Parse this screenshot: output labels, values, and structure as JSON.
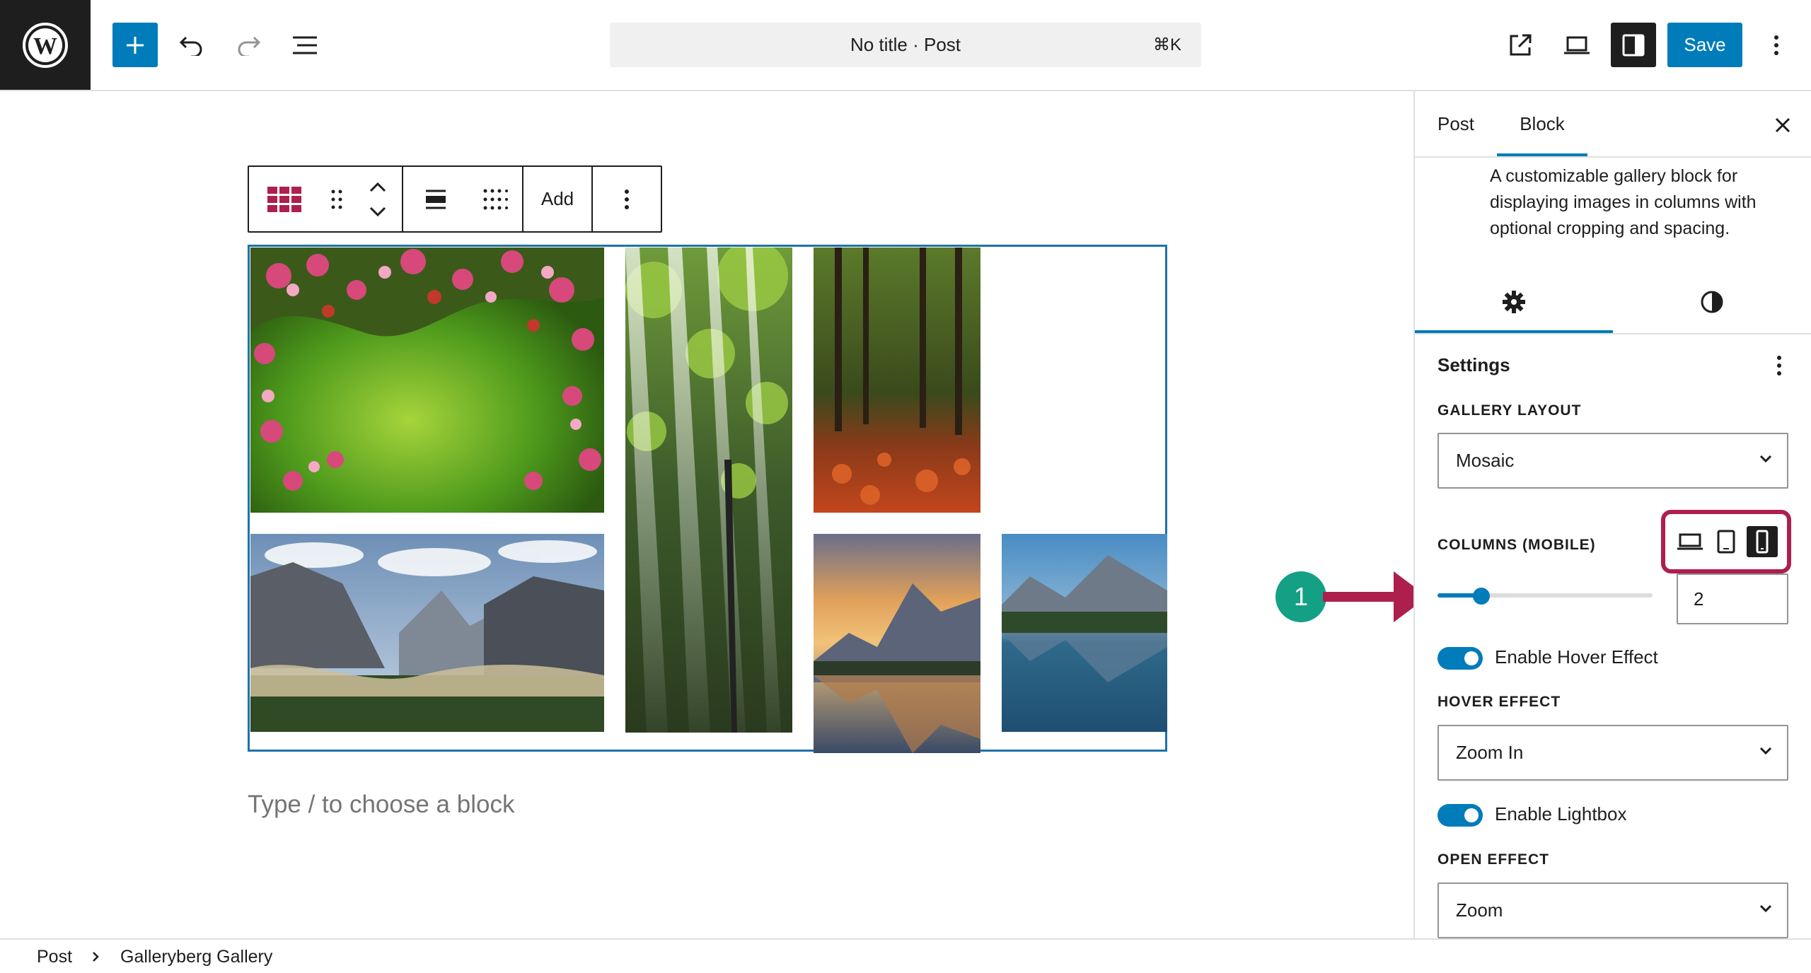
{
  "header": {
    "document_title": "No title · Post",
    "shortcut": "⌘K",
    "save_label": "Save"
  },
  "icons": {
    "logo": "wordpress-logo-icon",
    "inserter": "plus-icon",
    "undo": "undo-icon",
    "redo": "redo-icon",
    "document_overview": "list-view-icon",
    "view_post": "external-link-icon",
    "preview": "desktop-preview-icon",
    "settings": "sidebar-toggle-icon",
    "options": "vertical-ellipsis-icon"
  },
  "block_toolbar": {
    "add_label": "Add"
  },
  "editor": {
    "placeholder": "Type / to choose a block"
  },
  "sidebar": {
    "tabs": [
      {
        "label": "Post",
        "active": false
      },
      {
        "label": "Block",
        "active": true
      }
    ],
    "block_description": "A customizable gallery block for displaying images in columns with optional cropping and spacing.",
    "settings_title": "Settings",
    "gallery_layout_label": "GALLERY LAYOUT",
    "gallery_layout_value": "Mosaic",
    "columns_label": "COLUMNS (MOBILE)",
    "columns_value": "2",
    "columns_slider_fraction": 0.12,
    "devices": [
      "desktop",
      "tablet",
      "mobile"
    ],
    "active_device": "mobile",
    "hover_toggle_label": "Enable Hover Effect",
    "hover_toggle_on": true,
    "hover_effect_label": "HOVER EFFECT",
    "hover_effect_value": "Zoom In",
    "lightbox_toggle_label": "Enable Lightbox",
    "lightbox_toggle_on": true,
    "open_effect_label": "OPEN EFFECT",
    "open_effect_value": "Zoom"
  },
  "annotation": {
    "number": "1",
    "color": "#14a085",
    "arrow_color": "#ad1f4d"
  },
  "breadcrumb": {
    "items": [
      "Post",
      "Galleryberg Gallery"
    ]
  },
  "colors": {
    "accent": "#007cba",
    "dark": "#1e1e1e",
    "highlight": "#ad1f4d"
  }
}
